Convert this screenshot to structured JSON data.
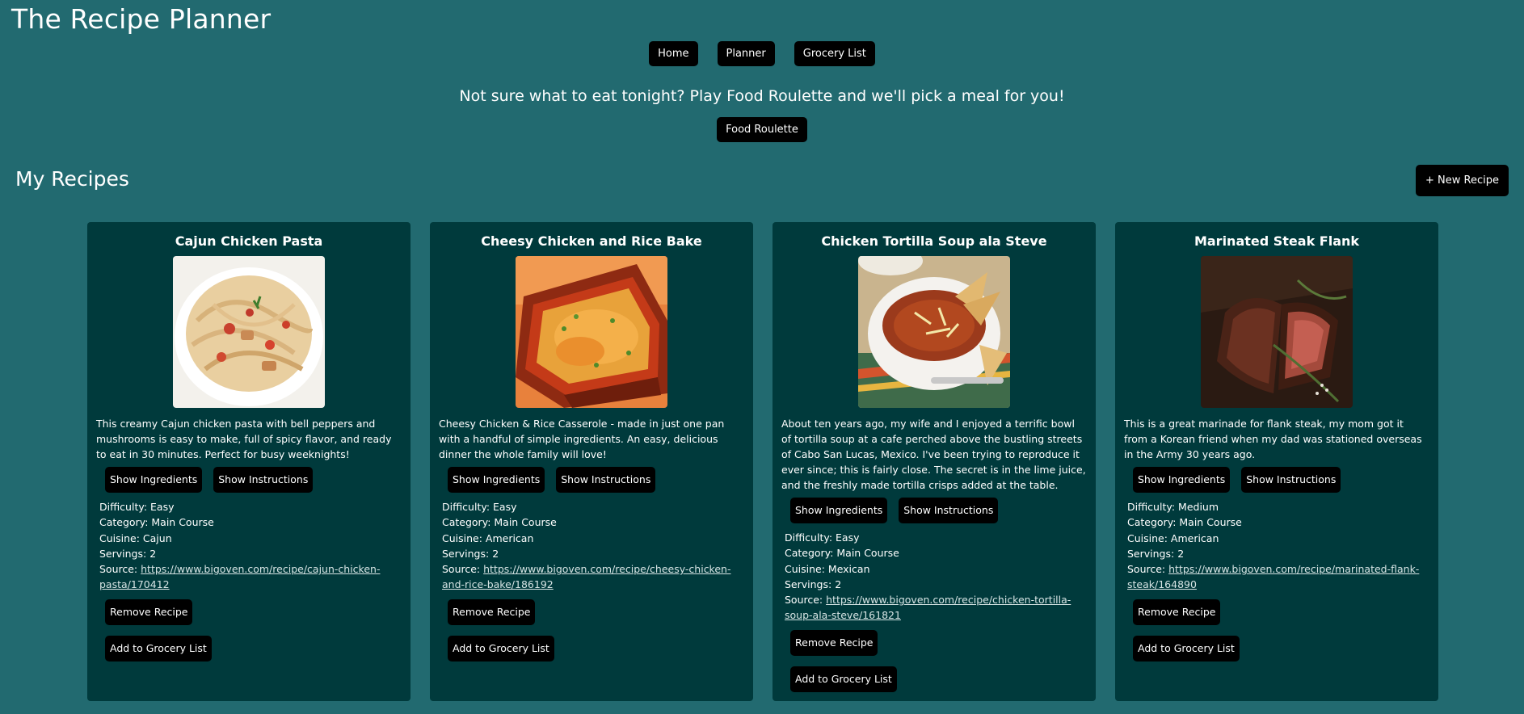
{
  "app": {
    "title": "The Recipe Planner"
  },
  "nav": {
    "home": "Home",
    "planner": "Planner",
    "grocery": "Grocery List"
  },
  "promo": {
    "text": "Not sure what to eat tonight? Play Food Roulette and we'll pick a meal for you!",
    "button": "Food Roulette"
  },
  "section": {
    "title": "My Recipes",
    "new_button": "+ New Recipe"
  },
  "labels": {
    "show_ingredients": "Show Ingredients",
    "show_instructions": "Show Instructions",
    "remove": "Remove Recipe",
    "add_grocery": "Add to Grocery List",
    "difficulty": "Difficulty: ",
    "category": "Category: ",
    "cuisine": "Cuisine: ",
    "servings": "Servings: ",
    "source": "Source: "
  },
  "recipes": [
    {
      "title": "Cajun Chicken Pasta",
      "description": "This creamy Cajun chicken pasta with bell peppers and mushrooms is easy to make, full of spicy flavor, and ready to eat in 30 minutes. Perfect for busy weeknights!",
      "difficulty": "Easy",
      "category": "Main Course",
      "cuisine": "Cajun",
      "servings": "2",
      "source": "https://www.bigoven.com/recipe/cajun-chicken-pasta/170412",
      "photo": "pasta-photo"
    },
    {
      "title": "Cheesy Chicken and Rice Bake",
      "description": "Cheesy Chicken & Rice Casserole - made in just one pan with a handful of simple ingredients. An easy, delicious dinner the whole family will love!",
      "difficulty": "Easy",
      "category": "Main Course",
      "cuisine": "American",
      "servings": "2",
      "source": "https://www.bigoven.com/recipe/cheesy-chicken-and-rice-bake/186192",
      "photo": "casserole-photo"
    },
    {
      "title": "Chicken Tortilla Soup ala Steve",
      "description": "About ten years ago, my wife and I enjoyed a terrific bowl of tortilla soup at a cafe perched above the bustling streets of Cabo San Lucas, Mexico. I've been trying to reproduce it ever since; this is fairly close. The secret is in the lime juice, and the freshly made tortilla crisps added at the table.",
      "difficulty": "Easy",
      "category": "Main Course",
      "cuisine": "Mexican",
      "servings": "2",
      "source": "https://www.bigoven.com/recipe/chicken-tortilla-soup-ala-steve/161821",
      "photo": "soup-photo"
    },
    {
      "title": "Marinated Steak Flank",
      "description": "This is a great marinade for flank steak, my mom got it from a Korean friend when my dad was stationed overseas in the Army 30 years ago.",
      "difficulty": "Medium",
      "category": "Main Course",
      "cuisine": "American",
      "servings": "2",
      "source": "https://www.bigoven.com/recipe/marinated-flank-steak/164890",
      "photo": "steak-photo"
    }
  ],
  "colors": {
    "background": "#226a70",
    "card": "#003a3c",
    "button": "#000000"
  }
}
